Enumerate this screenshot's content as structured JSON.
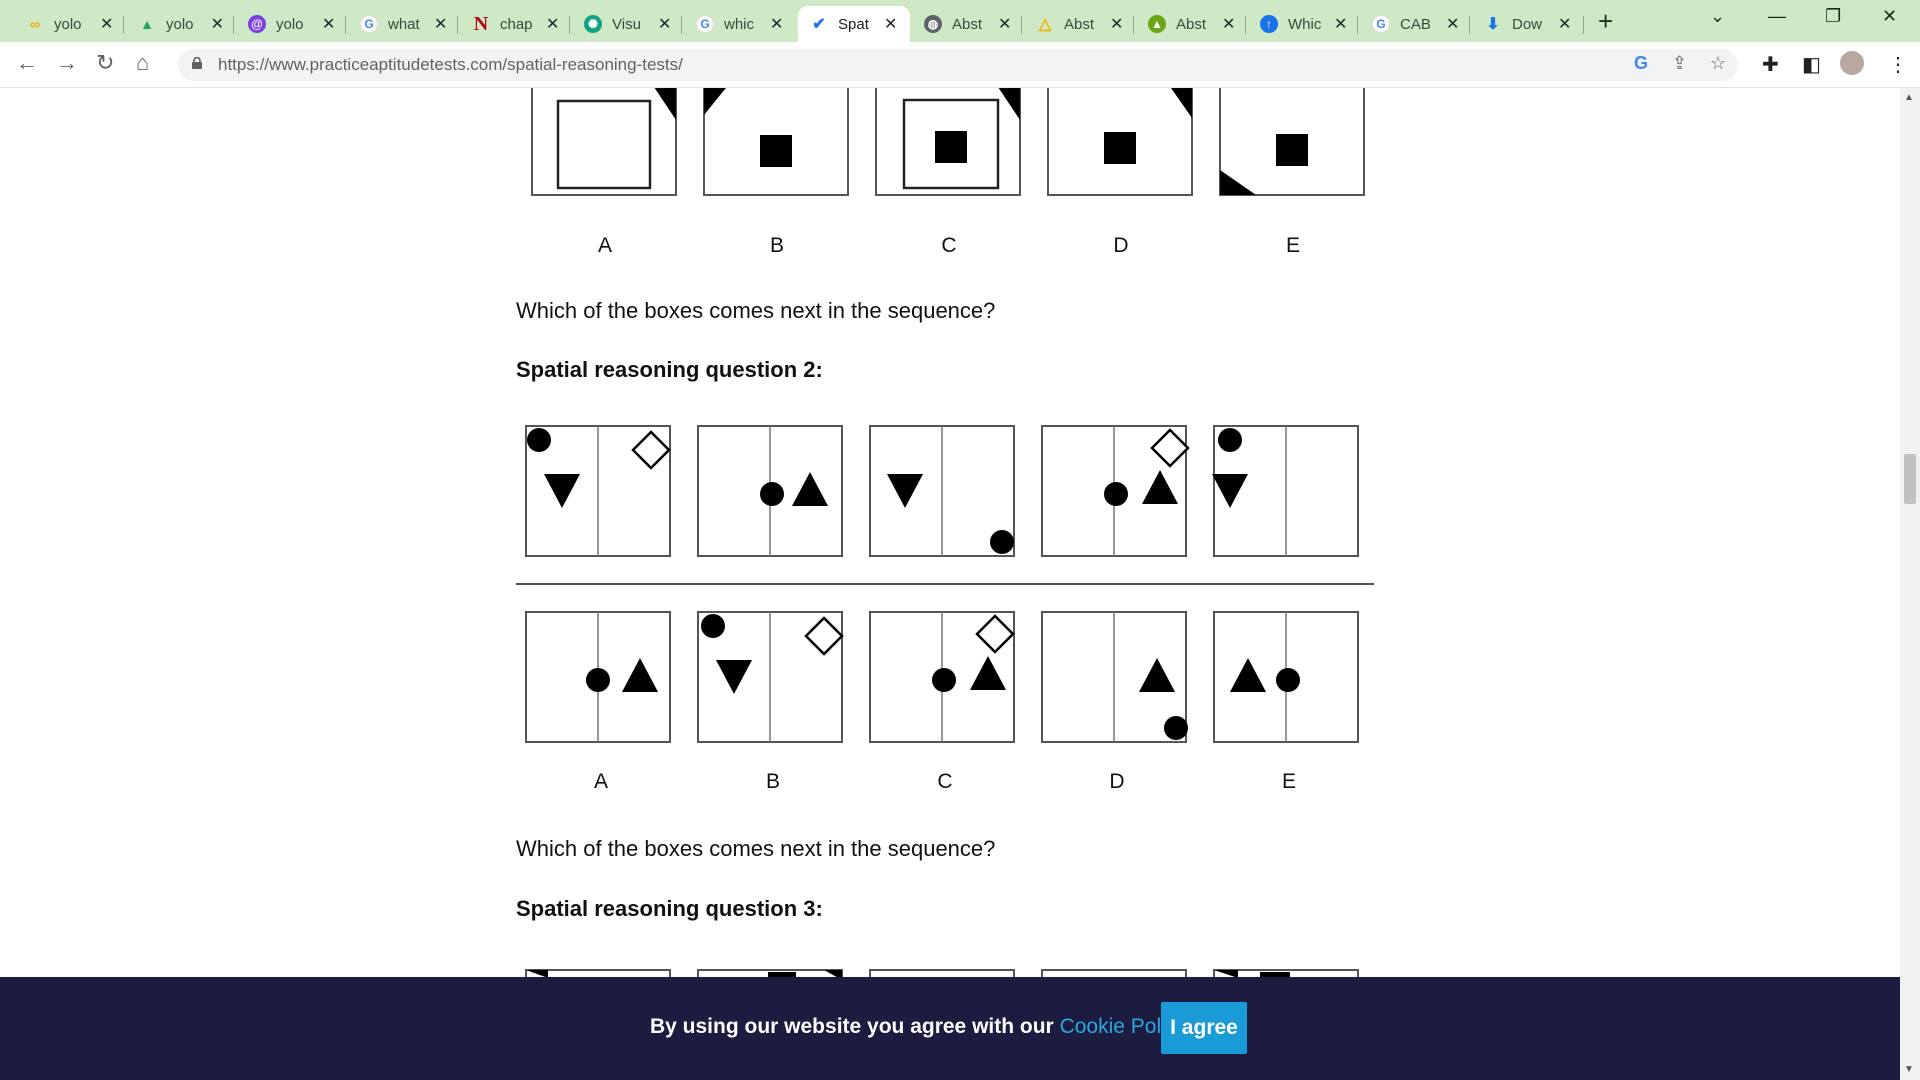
{
  "browser": {
    "tabs": [
      {
        "title": "yolo",
        "favicon": "colab-icon",
        "color": "#f9ab00"
      },
      {
        "title": "yolo",
        "favicon": "drive-icon",
        "color": "#1fa463"
      },
      {
        "title": "yolo",
        "favicon": "link-icon",
        "color": "#7b3fe4"
      },
      {
        "title": "what",
        "favicon": "google-icon",
        "color": "#4285f4"
      },
      {
        "title": "chap",
        "favicon": "netflix-icon",
        "color": "#b0060f"
      },
      {
        "title": "Visu",
        "favicon": "openai-icon",
        "color": "#10a37f"
      },
      {
        "title": "whic",
        "favicon": "google-icon",
        "color": "#4285f4"
      },
      {
        "title": "Spat",
        "favicon": "check-icon",
        "color": "#1a73e8",
        "active": true
      },
      {
        "title": "Abst",
        "favicon": "globe-icon",
        "color": "#5f6368"
      },
      {
        "title": "Abst",
        "favicon": "triangle-icon",
        "color": "#f0b400"
      },
      {
        "title": "Abst",
        "favicon": "tree-icon",
        "color": "#6aa513"
      },
      {
        "title": "Whic",
        "favicon": "upload-icon",
        "color": "#1a73e8"
      },
      {
        "title": "CAB",
        "favicon": "google-icon",
        "color": "#4285f4"
      },
      {
        "title": "Dow",
        "favicon": "download-icon",
        "color": "#1a73e8"
      }
    ],
    "url": "https://www.practiceaptitudetests.com/spatial-reasoning-tests/"
  },
  "page": {
    "q1_option_letters": [
      "A",
      "B",
      "C",
      "D",
      "E"
    ],
    "q1_prompt": "Which of the boxes comes next in the sequence?",
    "q2_heading": "Spatial reasoning question 2:",
    "q2_option_letters": [
      "A",
      "B",
      "C",
      "D",
      "E"
    ],
    "q2_prompt": "Which of the boxes comes next in the sequence?",
    "q3_heading": "Spatial reasoning question 3:"
  },
  "cookie_banner": {
    "message": "By using our website you agree with our",
    "link": "Cookie Policy.",
    "button": "I agree"
  }
}
